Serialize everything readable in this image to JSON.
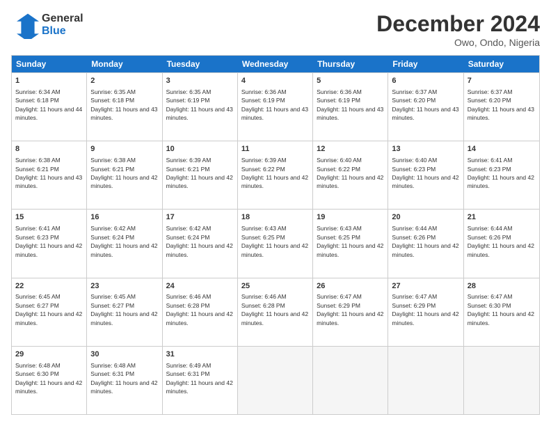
{
  "header": {
    "logo_line1": "General",
    "logo_line2": "Blue",
    "month_title": "December 2024",
    "location": "Owo, Ondo, Nigeria"
  },
  "weekdays": [
    "Sunday",
    "Monday",
    "Tuesday",
    "Wednesday",
    "Thursday",
    "Friday",
    "Saturday"
  ],
  "rows": [
    [
      {
        "day": "1",
        "sunrise": "6:34 AM",
        "sunset": "6:18 PM",
        "daylight": "11 hours and 44 minutes."
      },
      {
        "day": "2",
        "sunrise": "6:35 AM",
        "sunset": "6:18 PM",
        "daylight": "11 hours and 43 minutes."
      },
      {
        "day": "3",
        "sunrise": "6:35 AM",
        "sunset": "6:19 PM",
        "daylight": "11 hours and 43 minutes."
      },
      {
        "day": "4",
        "sunrise": "6:36 AM",
        "sunset": "6:19 PM",
        "daylight": "11 hours and 43 minutes."
      },
      {
        "day": "5",
        "sunrise": "6:36 AM",
        "sunset": "6:19 PM",
        "daylight": "11 hours and 43 minutes."
      },
      {
        "day": "6",
        "sunrise": "6:37 AM",
        "sunset": "6:20 PM",
        "daylight": "11 hours and 43 minutes."
      },
      {
        "day": "7",
        "sunrise": "6:37 AM",
        "sunset": "6:20 PM",
        "daylight": "11 hours and 43 minutes."
      }
    ],
    [
      {
        "day": "8",
        "sunrise": "6:38 AM",
        "sunset": "6:21 PM",
        "daylight": "11 hours and 43 minutes."
      },
      {
        "day": "9",
        "sunrise": "6:38 AM",
        "sunset": "6:21 PM",
        "daylight": "11 hours and 42 minutes."
      },
      {
        "day": "10",
        "sunrise": "6:39 AM",
        "sunset": "6:21 PM",
        "daylight": "11 hours and 42 minutes."
      },
      {
        "day": "11",
        "sunrise": "6:39 AM",
        "sunset": "6:22 PM",
        "daylight": "11 hours and 42 minutes."
      },
      {
        "day": "12",
        "sunrise": "6:40 AM",
        "sunset": "6:22 PM",
        "daylight": "11 hours and 42 minutes."
      },
      {
        "day": "13",
        "sunrise": "6:40 AM",
        "sunset": "6:23 PM",
        "daylight": "11 hours and 42 minutes."
      },
      {
        "day": "14",
        "sunrise": "6:41 AM",
        "sunset": "6:23 PM",
        "daylight": "11 hours and 42 minutes."
      }
    ],
    [
      {
        "day": "15",
        "sunrise": "6:41 AM",
        "sunset": "6:23 PM",
        "daylight": "11 hours and 42 minutes."
      },
      {
        "day": "16",
        "sunrise": "6:42 AM",
        "sunset": "6:24 PM",
        "daylight": "11 hours and 42 minutes."
      },
      {
        "day": "17",
        "sunrise": "6:42 AM",
        "sunset": "6:24 PM",
        "daylight": "11 hours and 42 minutes."
      },
      {
        "day": "18",
        "sunrise": "6:43 AM",
        "sunset": "6:25 PM",
        "daylight": "11 hours and 42 minutes."
      },
      {
        "day": "19",
        "sunrise": "6:43 AM",
        "sunset": "6:25 PM",
        "daylight": "11 hours and 42 minutes."
      },
      {
        "day": "20",
        "sunrise": "6:44 AM",
        "sunset": "6:26 PM",
        "daylight": "11 hours and 42 minutes."
      },
      {
        "day": "21",
        "sunrise": "6:44 AM",
        "sunset": "6:26 PM",
        "daylight": "11 hours and 42 minutes."
      }
    ],
    [
      {
        "day": "22",
        "sunrise": "6:45 AM",
        "sunset": "6:27 PM",
        "daylight": "11 hours and 42 minutes."
      },
      {
        "day": "23",
        "sunrise": "6:45 AM",
        "sunset": "6:27 PM",
        "daylight": "11 hours and 42 minutes."
      },
      {
        "day": "24",
        "sunrise": "6:46 AM",
        "sunset": "6:28 PM",
        "daylight": "11 hours and 42 minutes."
      },
      {
        "day": "25",
        "sunrise": "6:46 AM",
        "sunset": "6:28 PM",
        "daylight": "11 hours and 42 minutes."
      },
      {
        "day": "26",
        "sunrise": "6:47 AM",
        "sunset": "6:29 PM",
        "daylight": "11 hours and 42 minutes."
      },
      {
        "day": "27",
        "sunrise": "6:47 AM",
        "sunset": "6:29 PM",
        "daylight": "11 hours and 42 minutes."
      },
      {
        "day": "28",
        "sunrise": "6:47 AM",
        "sunset": "6:30 PM",
        "daylight": "11 hours and 42 minutes."
      }
    ],
    [
      {
        "day": "29",
        "sunrise": "6:48 AM",
        "sunset": "6:30 PM",
        "daylight": "11 hours and 42 minutes."
      },
      {
        "day": "30",
        "sunrise": "6:48 AM",
        "sunset": "6:31 PM",
        "daylight": "11 hours and 42 minutes."
      },
      {
        "day": "31",
        "sunrise": "6:49 AM",
        "sunset": "6:31 PM",
        "daylight": "11 hours and 42 minutes."
      },
      null,
      null,
      null,
      null
    ]
  ]
}
